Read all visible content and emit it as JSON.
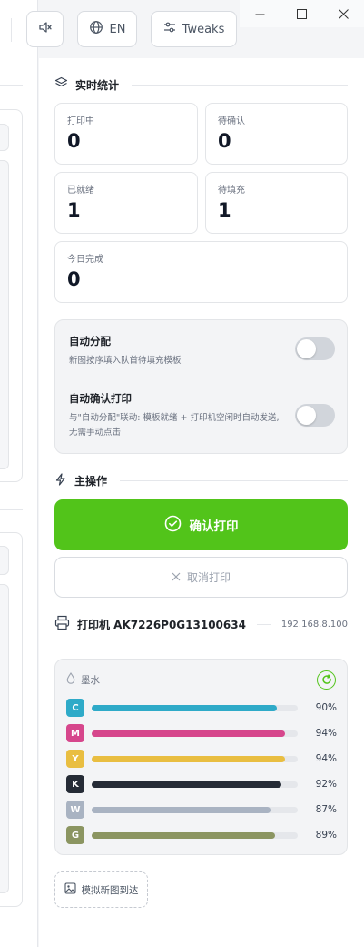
{
  "toolbar": {
    "mute_icon": "speaker-mute-icon",
    "lang_label": "EN",
    "tweaks_label": "Tweaks"
  },
  "stats": {
    "title": "实时统计",
    "printing": {
      "label": "打印中",
      "value": "0"
    },
    "pending_confirm": {
      "label": "待确认",
      "value": "0"
    },
    "ready": {
      "label": "已就绪",
      "value": "1"
    },
    "pending_fill": {
      "label": "待填充",
      "value": "1"
    },
    "today_done": {
      "label": "今日完成",
      "value": "0"
    }
  },
  "auto": {
    "assign_title": "自动分配",
    "assign_desc": "新图按序填入队首待填充模板",
    "assign_enabled": false,
    "confirm_title": "自动确认打印",
    "confirm_desc": "与\"自动分配\"联动: 模板就绪 + 打印机空闲时自动发送, 无需手动点击",
    "confirm_enabled": false
  },
  "actions": {
    "title": "主操作",
    "confirm_label": "确认打印",
    "cancel_label": "取消打印"
  },
  "printer": {
    "label": "打印机 AK7226P0G13100634",
    "ip": "192.168.8.100"
  },
  "ink": {
    "title": "墨水",
    "levels": [
      {
        "code": "C",
        "percent": 90,
        "label": "90%",
        "color": "#2eaac8"
      },
      {
        "code": "M",
        "percent": 94,
        "label": "94%",
        "color": "#d6468c"
      },
      {
        "code": "Y",
        "percent": 94,
        "label": "94%",
        "color": "#e9be41"
      },
      {
        "code": "K",
        "percent": 92,
        "label": "92%",
        "color": "#252b36"
      },
      {
        "code": "W",
        "percent": 87,
        "label": "87%",
        "color": "#a9b3c2"
      },
      {
        "code": "G",
        "percent": 89,
        "label": "89%",
        "color": "#8b9561"
      }
    ]
  },
  "simulate": {
    "label": "模拟新图到达"
  },
  "colors": {
    "accent": "#52c41a"
  }
}
